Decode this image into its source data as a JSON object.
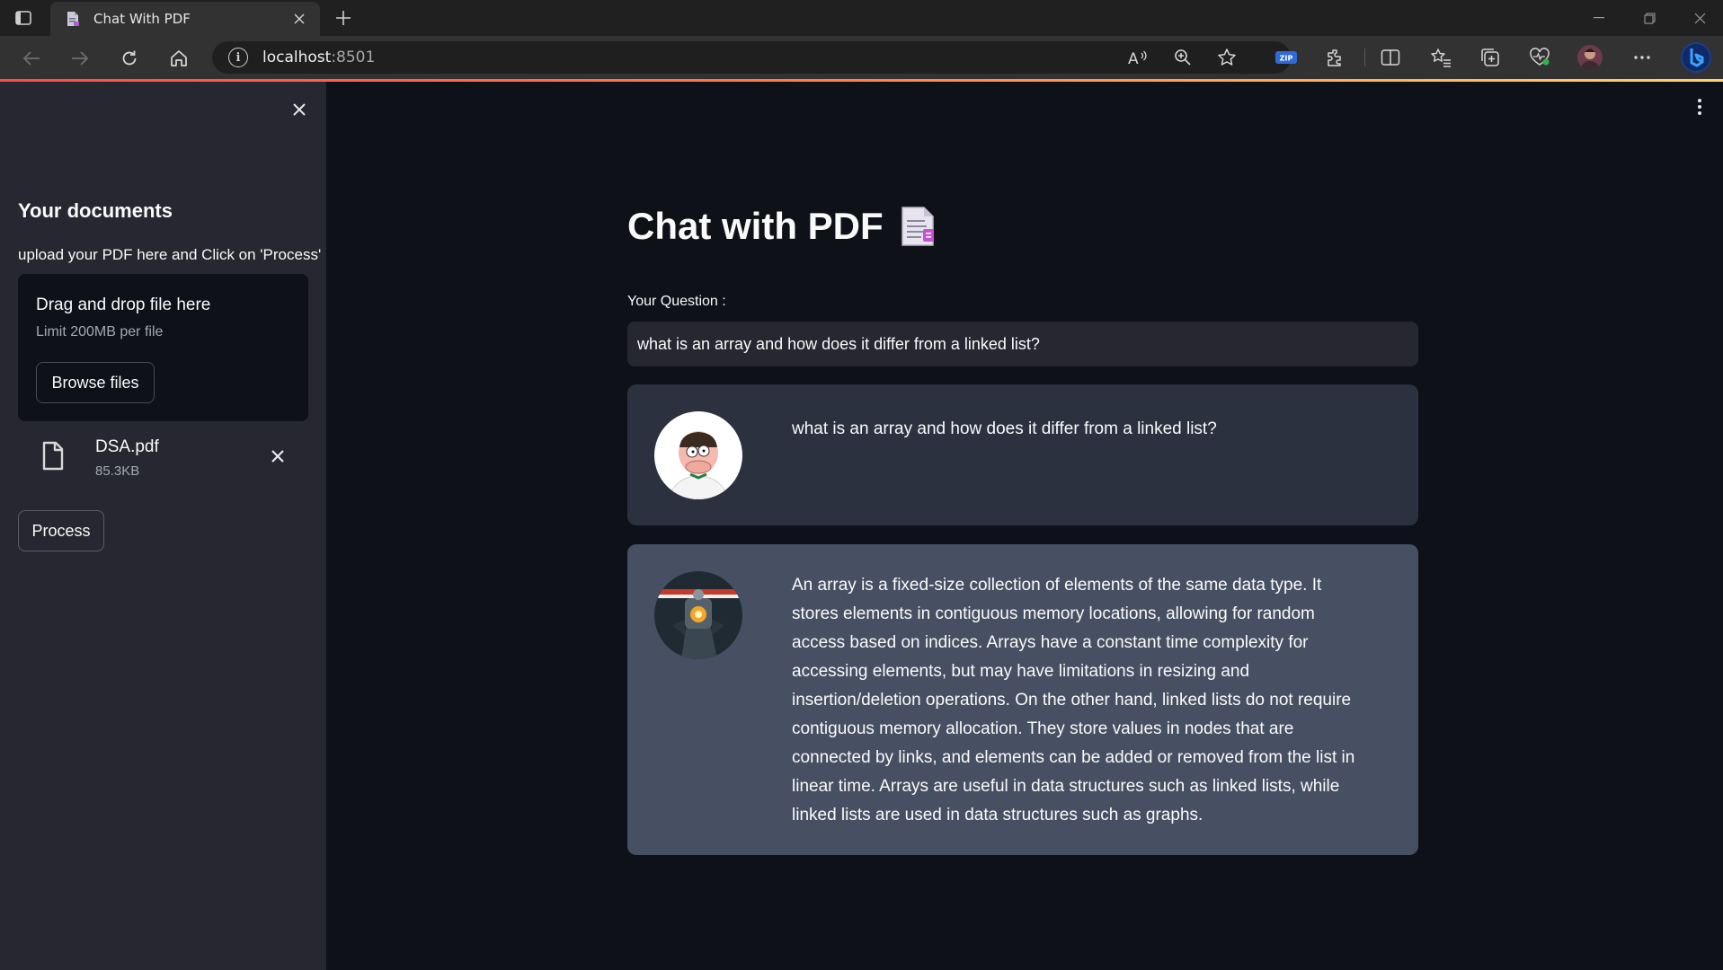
{
  "browser": {
    "tab_title": "Chat With PDF",
    "url_host": "localhost",
    "url_port": ":8501",
    "icons": [
      "tab-actions-icon",
      "back-icon",
      "forward-icon",
      "refresh-icon",
      "home-icon",
      "info-icon",
      "read-aloud-icon",
      "zoom-icon",
      "favorite-star-icon",
      "zip-extension-icon",
      "extensions-icon",
      "split-screen-icon",
      "favorites-icon",
      "collections-icon",
      "browser-essentials-icon",
      "profile-avatar",
      "more-icon",
      "copilot-icon"
    ],
    "zip_label": "ZIP"
  },
  "sidebar": {
    "heading": "Your documents",
    "subtext": "upload your PDF here and Click on 'Process'",
    "dropzone": {
      "title": "Drag and drop file here",
      "limit": "Limit 200MB per file",
      "browse_label": "Browse files"
    },
    "file": {
      "name": "DSA.pdf",
      "size": "85.3KB"
    },
    "process_label": "Process"
  },
  "main": {
    "title": "Chat with PDF",
    "question_label": "Your Question :",
    "question_value": "what is an array and how does it differ from a linked list?",
    "messages": {
      "user": "what is an array and how does it differ from a linked list?",
      "bot": "An array is a fixed-size collection of elements of the same data type. It stores elements in contiguous memory locations, allowing for random access based on indices. Arrays have a constant time complexity for accessing elements, but may have limitations in resizing and insertion/deletion operations. On the other hand, linked lists do not require contiguous memory allocation. They store values in nodes that are connected by links, and elements can be added or removed from the list in linear time. Arrays are useful in data structures such as linked lists, while linked lists are used in data structures such as graphs."
    }
  },
  "colors": {
    "app_bg": "#0e1117",
    "sidebar_bg": "#262730",
    "user_msg_bg": "#2b313e",
    "bot_msg_bg": "#475063",
    "accent": "#ff4b4b"
  }
}
